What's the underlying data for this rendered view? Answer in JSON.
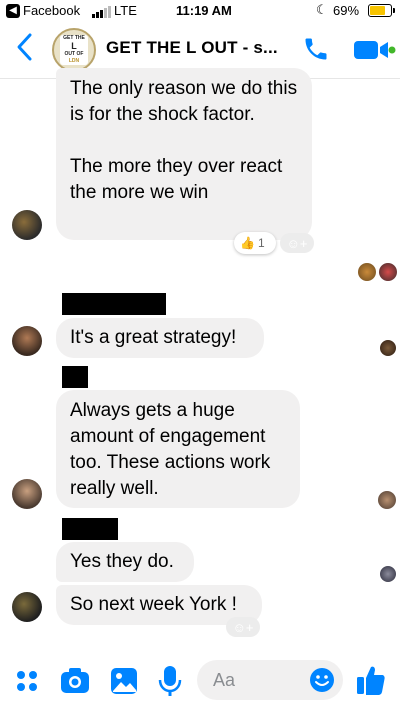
{
  "status_bar": {
    "back_app": "Facebook",
    "network": "LTE",
    "time": "11:19 AM",
    "battery_percent": "69%",
    "battery_level": 0.69
  },
  "header": {
    "title": "GET THE L OUT - s...",
    "logo_text": [
      "GET THE",
      "L",
      "OUT OF",
      "LDN"
    ]
  },
  "messages": [
    {
      "text": "The only reason we do this is for the shock factor.\n\nThe more they over react the more we win",
      "reaction_emoji": "👍",
      "reaction_count": "1"
    },
    {
      "text": "It's a great strategy!"
    },
    {
      "text": "Always gets a huge amount of engagement too. These actions work really well."
    },
    {
      "text": "Yes they do."
    },
    {
      "text": "So next week York !"
    }
  ],
  "reaction_add_icon": "☺+",
  "composer": {
    "placeholder": "Aa"
  },
  "colors": {
    "accent": "#0084ff",
    "bubble": "#f1f0f0",
    "reaction_yellow": "#f7b928"
  }
}
